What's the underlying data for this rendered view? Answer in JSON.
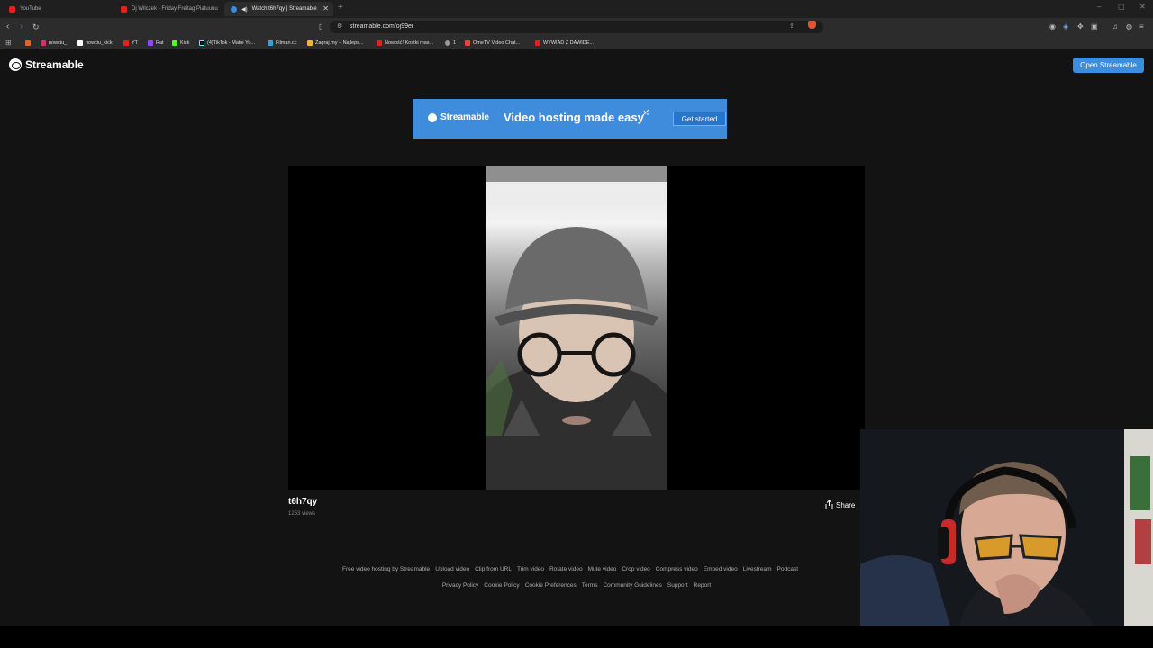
{
  "tabs": [
    {
      "title": "YouTube"
    },
    {
      "title": "Dj Wilczek - Friday Freitag Piątuuuu"
    },
    {
      "title": "Watch t6h7qy | Streamable"
    }
  ],
  "address_bar": {
    "url": "streamable.com/oj99ei"
  },
  "bookmarks": [
    {
      "label": "nowciu_"
    },
    {
      "label": "nowciu_kick"
    },
    {
      "label": "YT"
    },
    {
      "label": "Rat"
    },
    {
      "label": "Kick"
    },
    {
      "label": "(4)TikTok - Make Yo..."
    },
    {
      "label": "Filman.cc"
    },
    {
      "label": "Zagraj.my – Najleps..."
    },
    {
      "label": "Nowość! Kostki mas..."
    },
    {
      "label": "1"
    },
    {
      "label": "OmeTV Video Chat..."
    },
    {
      "label": "WYWIAD Z DAWIDE..."
    }
  ],
  "site": {
    "logo_text": "Streamable",
    "open_button": "Open Streamable"
  },
  "ad": {
    "brand": "Streamable",
    "tagline": "Video hosting made easy",
    "cta": "Get started"
  },
  "video": {
    "title": "t6h7qy",
    "views": "1253 views",
    "share_label": "Share"
  },
  "footer": {
    "row1": [
      "Free video hosting by Streamable",
      "Upload video",
      "Clip from URL",
      "Trim video",
      "Rotate video",
      "Mute video",
      "Crop video",
      "Compress video",
      "Embed video",
      "Livestream",
      "Podcast"
    ],
    "row2": [
      "Privacy Policy",
      "Cookie Policy",
      "Cookie Preferences",
      "Terms",
      "Community Guidelines",
      "Support",
      "Report"
    ]
  },
  "colors": {
    "accent": "#3b8de0",
    "page_bg": "#131313",
    "browser_chrome": "#2c2c2c"
  }
}
